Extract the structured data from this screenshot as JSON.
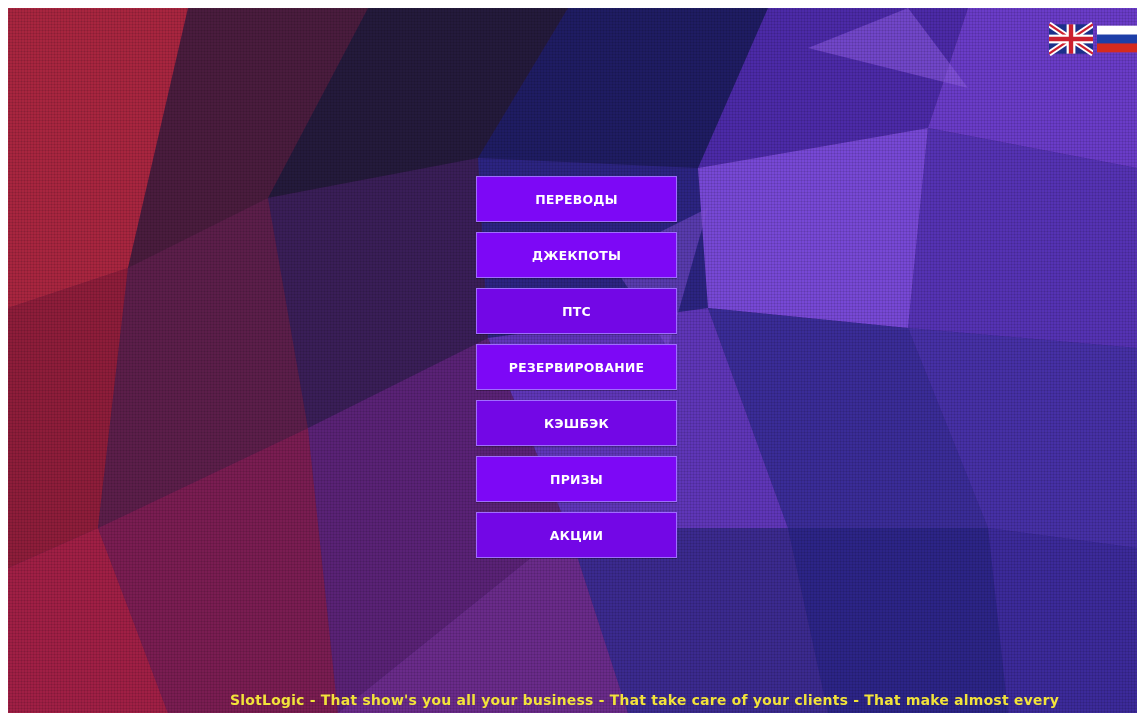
{
  "languages": [
    {
      "code": "en",
      "icon": "uk-flag-icon"
    },
    {
      "code": "ru",
      "icon": "russia-flag-icon"
    }
  ],
  "menu": {
    "items": [
      {
        "label": "ПЕРЕВОДЫ"
      },
      {
        "label": "ДЖЕКПОТЫ"
      },
      {
        "label": "ПТС"
      },
      {
        "label": "РЕЗЕРВИРОВАНИЕ"
      },
      {
        "label": "КЭШБЭК"
      },
      {
        "label": "ПРИЗЫ"
      },
      {
        "label": "АКЦИИ"
      }
    ]
  },
  "ticker": {
    "text": "SlotLogic  - That show's you all your business - That take care of your clients - That make almost every"
  },
  "colors": {
    "button": "#7d08f6",
    "button_border": "#a06cff",
    "ticker_text": "#f2e33a"
  }
}
